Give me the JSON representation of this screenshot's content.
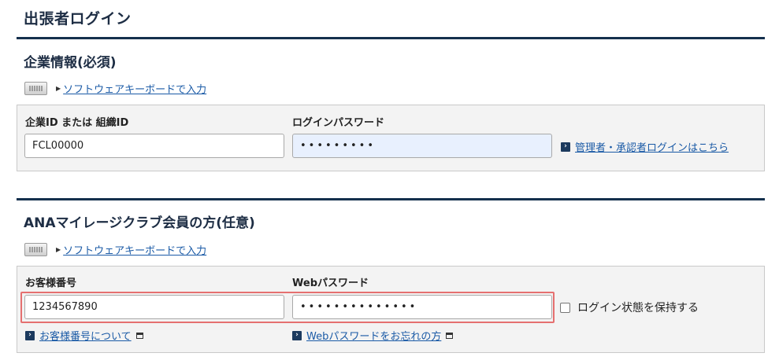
{
  "page": {
    "title": "出張者ログイン"
  },
  "corporate": {
    "title": "企業情報(必須)",
    "keyboard_link": "ソフトウェアキーボードで入力",
    "id_label": "企業ID または 組織ID",
    "id_value": "FCL00000",
    "password_label": "ログインパスワード",
    "password_value": "•••••••••",
    "admin_link": "管理者・承認者ログインはこちら"
  },
  "ana": {
    "title": "ANAマイレージクラブ会員の方(任意)",
    "keyboard_link": "ソフトウェアキーボードで入力",
    "number_label": "お客様番号",
    "number_value": "1234567890",
    "web_password_label": "Webパスワード",
    "web_password_value": "••••••••••••••",
    "keep_login_label": "ログイン状態を保持する",
    "number_help_link": "お客様番号について",
    "forgot_password_link": "Webパスワードをお忘れの方"
  },
  "colors": {
    "accent": "#14304d",
    "link": "#1a5aa6",
    "highlight": "#e57070",
    "autofill": "#e8f0fe"
  },
  "icons": [
    "keyboard-icon",
    "triangle-right-icon",
    "arrow-right-icon",
    "popup-window-icon"
  ]
}
